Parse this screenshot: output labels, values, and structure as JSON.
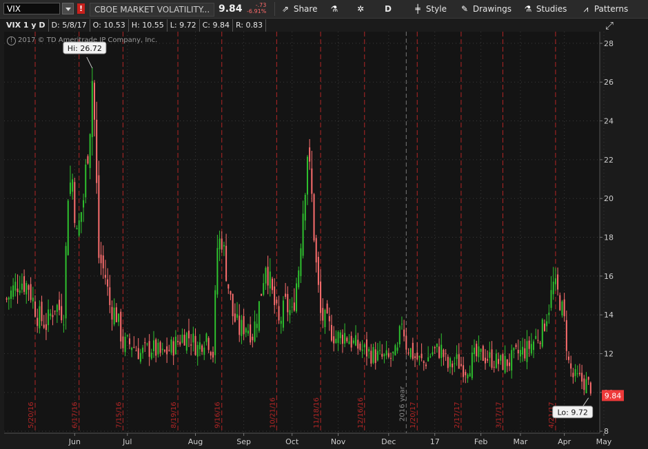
{
  "toolbar": {
    "symbol": "VIX",
    "alert_badge": "!",
    "description": "CBOE MARKET VOLATILITY...",
    "last_price": "9.84",
    "net_change": "-.73",
    "pct_change": "-6.91%",
    "share_label": "Share",
    "period_label": "D",
    "style_label": "Style",
    "drawings_label": "Drawings",
    "studies_label": "Studies",
    "patterns_label": "Patterns"
  },
  "info_bar": {
    "title": "VIX 1 y D",
    "date": "D: 5/8/17",
    "open": "O: 10.53",
    "high": "H: 10.55",
    "low": "L: 9.72",
    "close": "C: 9.84",
    "range": "R: 0.83"
  },
  "copyright": "2017 © TD Ameritrade IP Company, Inc.",
  "colors": {
    "up": "#2fc32f",
    "down": "#ff6f6f",
    "earnings_line": "#b52626",
    "year_line": "#7a7a7a",
    "last_price_bg": "#ee3a3a",
    "grid": "#3a3a3a"
  },
  "chart_data": {
    "type": "candlestick",
    "symbol": "VIX",
    "ylim": [
      7.9,
      28.6
    ],
    "y_ticks": [
      8,
      10,
      12,
      14,
      16,
      18,
      20,
      22,
      24,
      26,
      28
    ],
    "x_month_labels": [
      "Jun",
      "Jul",
      "Aug",
      "Sep",
      "Oct",
      "Nov",
      "Dec",
      "17",
      "Feb",
      "Mar",
      "Apr",
      "May"
    ],
    "x_month_positions": [
      31,
      55,
      86,
      108,
      130,
      151,
      174,
      195,
      216,
      234,
      254,
      272
    ],
    "event_dates": [
      {
        "label": "5/20/16",
        "day": 13
      },
      {
        "label": "6/17/16",
        "day": 33
      },
      {
        "label": "7/15/16",
        "day": 53
      },
      {
        "label": "8/19/16",
        "day": 78
      },
      {
        "label": "9/16/16",
        "day": 98
      },
      {
        "label": "10/21/16",
        "day": 123
      },
      {
        "label": "11/18/16",
        "day": 143
      },
      {
        "label": "12/16/16",
        "day": 163
      },
      {
        "label": "1/20/17",
        "day": 187
      },
      {
        "label": "2/17/17",
        "day": 207
      },
      {
        "label": "3/17/17",
        "day": 226
      },
      {
        "label": "4/21/17",
        "day": 250
      }
    ],
    "year_marker": {
      "label": "2016 year",
      "day": 182
    },
    "high_marker": {
      "label": "Hi: 26.72",
      "value": 26.72,
      "day": 39
    },
    "low_marker": {
      "label": "Lo: 9.72",
      "value": 9.72,
      "day": 265
    },
    "last_price": 9.84,
    "anchors": [
      [
        0,
        14.8
      ],
      [
        6,
        15.8
      ],
      [
        10,
        15.5
      ],
      [
        14,
        14.0
      ],
      [
        18,
        13.5
      ],
      [
        22,
        14.5
      ],
      [
        26,
        14.1
      ],
      [
        28,
        20.5
      ],
      [
        30,
        21.0
      ],
      [
        32,
        18.0
      ],
      [
        35,
        20.0
      ],
      [
        38,
        24.0
      ],
      [
        39,
        26.2
      ],
      [
        40,
        24.0
      ],
      [
        42,
        17.0
      ],
      [
        45,
        16.0
      ],
      [
        47,
        14.5
      ],
      [
        50,
        14.0
      ],
      [
        53,
        12.5
      ],
      [
        57,
        12.5
      ],
      [
        61,
        12.0
      ],
      [
        66,
        12.3
      ],
      [
        71,
        11.9
      ],
      [
        76,
        12.4
      ],
      [
        81,
        13.0
      ],
      [
        84,
        12.8
      ],
      [
        87,
        12.3
      ],
      [
        91,
        13.0
      ],
      [
        94,
        12.0
      ],
      [
        96,
        17.5
      ],
      [
        98,
        18.0
      ],
      [
        101,
        15.5
      ],
      [
        103,
        14.0
      ],
      [
        106,
        13.2
      ],
      [
        109,
        13.5
      ],
      [
        112,
        13.0
      ],
      [
        115,
        14.5
      ],
      [
        118,
        16.8
      ],
      [
        121,
        15.0
      ],
      [
        124,
        13.5
      ],
      [
        127,
        14.5
      ],
      [
        130,
        14.0
      ],
      [
        133,
        16.5
      ],
      [
        135,
        19.5
      ],
      [
        137,
        22.5
      ],
      [
        139,
        20.0
      ],
      [
        141,
        16.5
      ],
      [
        143,
        14.0
      ],
      [
        146,
        13.5
      ],
      [
        150,
        12.8
      ],
      [
        154,
        13.0
      ],
      [
        158,
        12.5
      ],
      [
        162,
        12.2
      ],
      [
        166,
        12.0
      ],
      [
        170,
        11.8
      ],
      [
        174,
        11.7
      ],
      [
        178,
        12.0
      ],
      [
        180,
        13.8
      ],
      [
        182,
        12.5
      ],
      [
        186,
        11.8
      ],
      [
        190,
        11.5
      ],
      [
        194,
        12.1
      ],
      [
        198,
        12.2
      ],
      [
        201,
        11.3
      ],
      [
        205,
        11.6
      ],
      [
        209,
        11.2
      ],
      [
        213,
        11.8
      ],
      [
        217,
        11.9
      ],
      [
        221,
        11.7
      ],
      [
        225,
        11.5
      ],
      [
        229,
        11.6
      ],
      [
        233,
        12.0
      ],
      [
        237,
        12.2
      ],
      [
        241,
        12.8
      ],
      [
        244,
        13.2
      ],
      [
        247,
        14.5
      ],
      [
        249,
        15.5
      ],
      [
        252,
        14.8
      ],
      [
        254,
        13.6
      ],
      [
        256,
        11.5
      ],
      [
        258,
        10.8
      ],
      [
        262,
        10.6
      ],
      [
        266,
        10.3
      ]
    ]
  }
}
